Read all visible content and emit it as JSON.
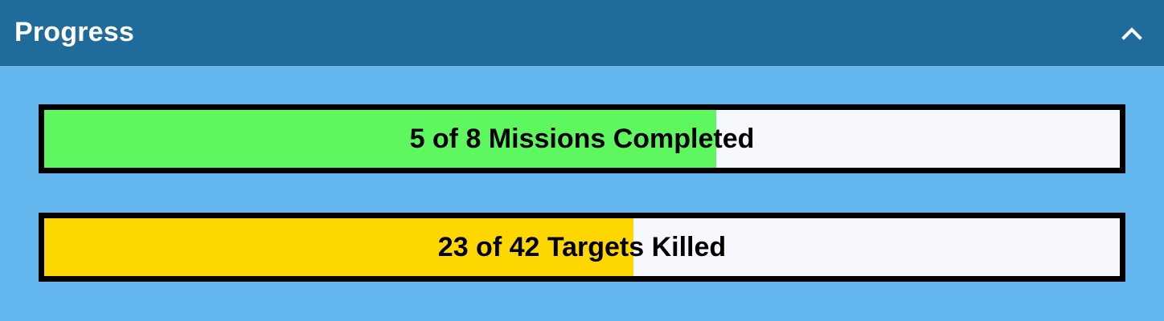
{
  "panel": {
    "title": "Progress",
    "collapse_icon": "chevron-up-icon",
    "colors": {
      "header_bg": "#1f6b9c",
      "body_bg": "#63b5ed",
      "bar_track": "#f7f8fd",
      "bar_border": "#000000"
    }
  },
  "progress_bars": [
    {
      "label": "5 of 8 Missions Completed",
      "completed": 5,
      "total": 8,
      "fill_color": "#5ef75f"
    },
    {
      "label": "23 of 42 Targets Killed",
      "completed": 23,
      "total": 42,
      "fill_color": "#ffd700"
    }
  ]
}
